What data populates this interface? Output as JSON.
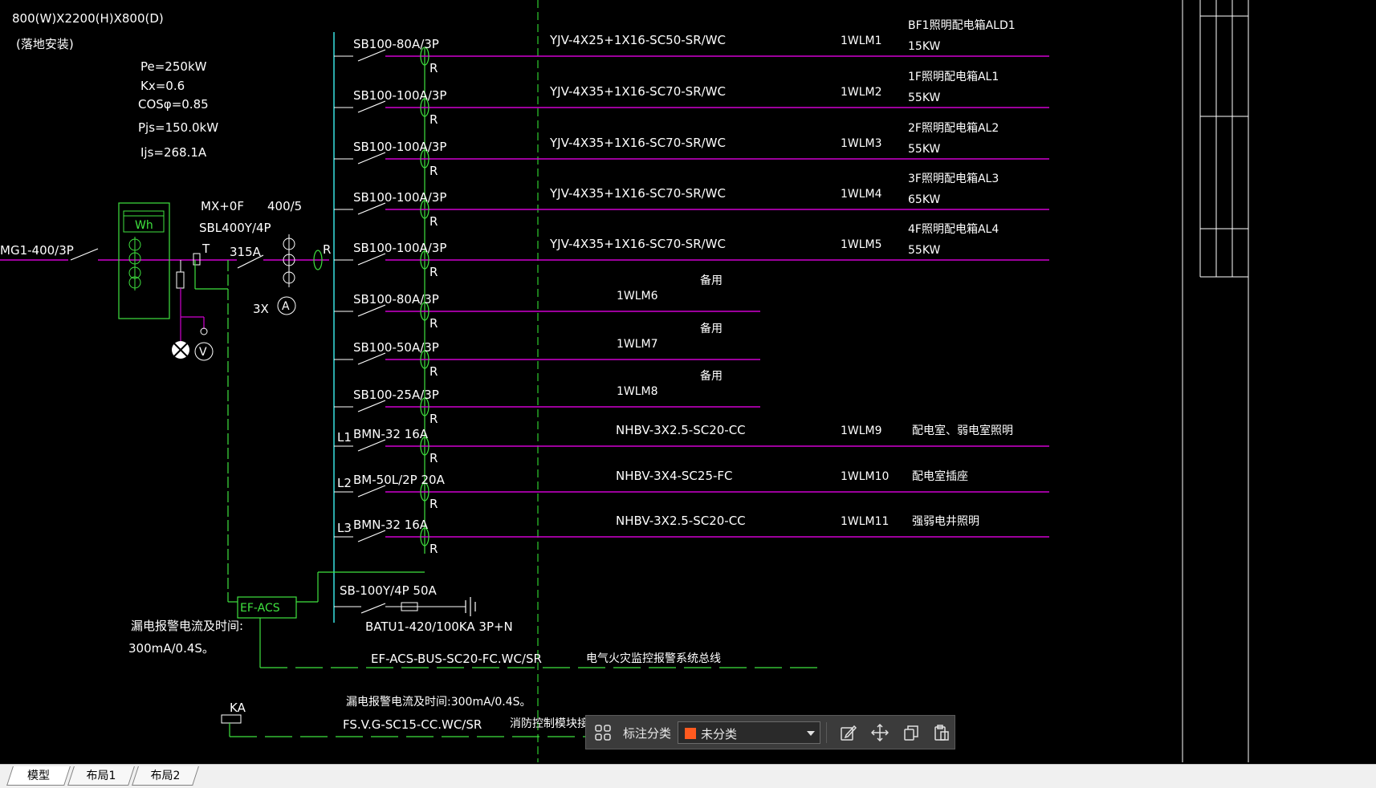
{
  "colors": {
    "background": "#000000",
    "bus_cyan": "#2aa8a8",
    "feeder_magenta": "#d000d0",
    "green": "#3fe23f",
    "divider_green": "#2ecc2e",
    "annotation_swatch": "#ff5a1f"
  },
  "panel": {
    "dimensions": "800(W)X2200(H)X800(D)",
    "mounting": "(落地安装)",
    "pe": "Pe=250kW",
    "kx": "Kx=0.6",
    "cos": "COSφ=0.85",
    "pjs": "Pjs=150.0kW",
    "ijs": "Ijs=268.1A"
  },
  "incoming": {
    "cable": "MG1-400/3P",
    "meter": "Wh",
    "breaker_mx": "MX+0F",
    "ct_ratio": "400/5",
    "main_breaker": "SBL400Y/4P",
    "t_mark": "T",
    "rating": "315A",
    "r_mark": "R",
    "ammeter_count": "3X",
    "ammeter": "A",
    "voltmeter": "V"
  },
  "feeders": [
    {
      "breaker": "SB100-80A/3P",
      "r": "R",
      "cable": "YJV-4X25+1X16-SC50-SR/WC",
      "id": "1WLM1",
      "load": "BF1照明配电箱ALD1",
      "power": "15KW",
      "phase": ""
    },
    {
      "breaker": "SB100-100A/3P",
      "r": "R",
      "cable": "YJV-4X35+1X16-SC70-SR/WC",
      "id": "1WLM2",
      "load": "1F照明配电箱AL1",
      "power": "55KW",
      "phase": ""
    },
    {
      "breaker": "SB100-100A/3P",
      "r": "R",
      "cable": "YJV-4X35+1X16-SC70-SR/WC",
      "id": "1WLM3",
      "load": "2F照明配电箱AL2",
      "power": "55KW",
      "phase": ""
    },
    {
      "breaker": "SB100-100A/3P",
      "r": "R",
      "cable": "YJV-4X35+1X16-SC70-SR/WC",
      "id": "1WLM4",
      "load": "3F照明配电箱AL3",
      "power": "65KW",
      "phase": ""
    },
    {
      "breaker": "SB100-100A/3P",
      "r": "R",
      "cable": "YJV-4X35+1X16-SC70-SR/WC",
      "id": "1WLM5",
      "load": "4F照明配电箱AL4",
      "power": "55KW",
      "phase": ""
    },
    {
      "breaker": "SB100-80A/3P",
      "r": "R",
      "cable": "",
      "id": "1WLM6",
      "load": "备用",
      "power": "",
      "phase": ""
    },
    {
      "breaker": "SB100-50A/3P",
      "r": "R",
      "cable": "",
      "id": "1WLM7",
      "load": "备用",
      "power": "",
      "phase": ""
    },
    {
      "breaker": "SB100-25A/3P",
      "r": "R",
      "cable": "",
      "id": "1WLM8",
      "load": "备用",
      "power": "",
      "phase": ""
    },
    {
      "breaker": "BMN-32 16A",
      "r": "R",
      "cable": "NHBV-3X2.5-SC20-CC",
      "id": "1WLM9",
      "load": "配电室、弱电室照明",
      "power": "",
      "phase": "L1"
    },
    {
      "breaker": "BM-50L/2P 20A",
      "r": "R",
      "cable": "NHBV-3X4-SC25-FC",
      "id": "1WLM10",
      "load": "配电室插座",
      "power": "",
      "phase": "L2"
    },
    {
      "breaker": "BMN-32 16A",
      "r": "R",
      "cable": "NHBV-3X2.5-SC20-CC",
      "id": "1WLM11",
      "load": "强弱电井照明",
      "power": "",
      "phase": "L3"
    }
  ],
  "surge": {
    "breaker": "SB-100Y/4P 50A",
    "spd": "BATU1-420/100KA 3P+N"
  },
  "monitoring": {
    "module": "EF-ACS",
    "alarm_label": "漏电报警电流及时间:",
    "alarm_value": "300mA/0.4S。",
    "bus_cable": "EF-ACS-BUS-SC20-FC.WC/SR",
    "bus_desc": "电气火灾监控报警系统总线",
    "ka": "KA",
    "fire_alarm": "漏电报警电流及时间:300mA/0.4S。",
    "fire_cable": "FS.V.G-SC15-CC.WC/SR",
    "fire_desc": "消防控制模块接口"
  },
  "annotation_toolbar": {
    "label": "标注分类",
    "category": "未分类",
    "icons": [
      "grid-icon",
      "edit-icon",
      "move-icon",
      "copy-icon",
      "paste-icon"
    ]
  },
  "layout_tabs": [
    "模型",
    "布局1",
    "布局2"
  ]
}
